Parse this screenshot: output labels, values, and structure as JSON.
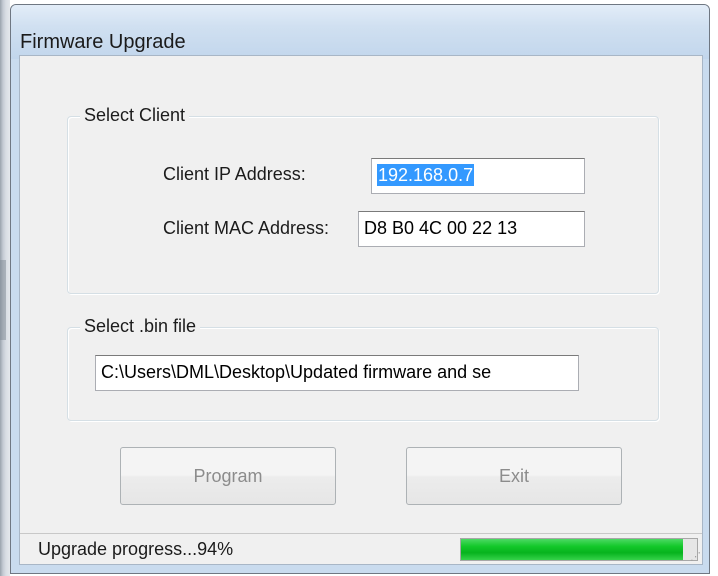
{
  "window": {
    "title": "Firmware Upgrade"
  },
  "select_client": {
    "label": "Select Client",
    "ip_label": "Client IP Address:",
    "ip_value": "192.168.0.7",
    "mac_label": "Client MAC Address:",
    "mac_value": "D8 B0 4C 00 22 13"
  },
  "select_bin": {
    "label": "Select .bin file",
    "path_value": "C:\\Users\\DML\\Desktop\\Updated firmware and se"
  },
  "buttons": {
    "program_label": "Program",
    "exit_label": "Exit"
  },
  "status": {
    "text": "Upgrade progress...94%",
    "progress_percent": 94
  },
  "colors": {
    "progress_fill": "#13c82a",
    "selection": "#3399ff",
    "titlebar": "#c9dbee"
  }
}
